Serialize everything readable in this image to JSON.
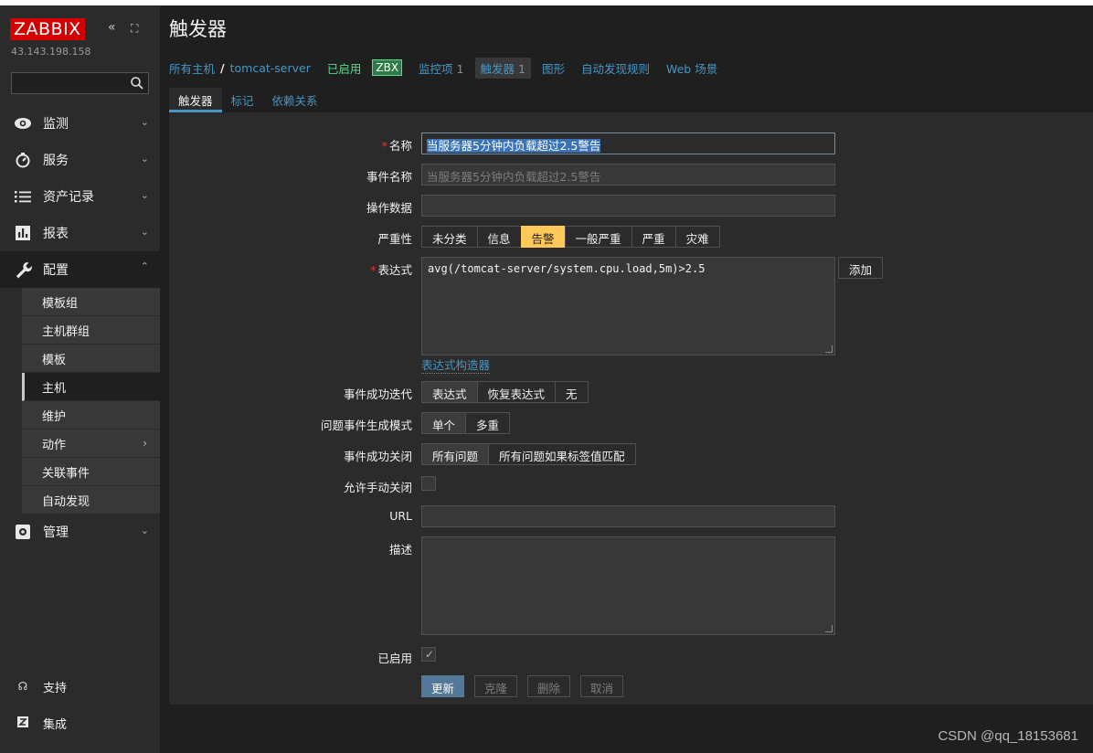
{
  "sidebar": {
    "logo": "ZABBIX",
    "collapse_glyph": "«",
    "kiosk_glyph": "⛶",
    "server_ip": "43.143.198.158",
    "search_value": "",
    "menu": [
      {
        "label": "监测",
        "icon": "eye-icon"
      },
      {
        "label": "服务",
        "icon": "stopwatch-icon"
      },
      {
        "label": "资产记录",
        "icon": "list-icon"
      },
      {
        "label": "报表",
        "icon": "bar-chart-icon"
      },
      {
        "label": "配置",
        "icon": "wrench-icon"
      },
      {
        "label": "管理",
        "icon": "gear-icon"
      }
    ],
    "submenu": [
      "模板组",
      "主机群组",
      "模板",
      "主机",
      "维护",
      "动作",
      "关联事件",
      "自动发现"
    ],
    "submenu_selected": "主机",
    "bottom": [
      {
        "label": "支持",
        "icon": "headset-icon"
      },
      {
        "label": "集成",
        "icon": "integration-icon"
      }
    ]
  },
  "header": {
    "title": "触发器"
  },
  "breadcrumbs": {
    "all_hosts": "所有主机",
    "separator": "/",
    "host": "tomcat-server",
    "status": "已启用",
    "zbx": "ZBX",
    "items_label": "监控项",
    "items_count": "1",
    "triggers_label": "触发器",
    "triggers_count": "1",
    "graphs_label": "图形",
    "discovery_label": "自动发现规则",
    "web_label": "Web 场景"
  },
  "tabs": [
    "触发器",
    "标记",
    "依赖关系"
  ],
  "form": {
    "name_label": "名称",
    "name_value": "当服务器5分钟内负载超过2.5警告",
    "event_name_label": "事件名称",
    "event_name_placeholder": "当服务器5分钟内负载超过2.5警告",
    "opdata_label": "操作数据",
    "opdata_value": "",
    "severity_label": "严重性",
    "severities": [
      "未分类",
      "信息",
      "告警",
      "一般严重",
      "严重",
      "灾难"
    ],
    "severity_selected": "告警",
    "expression_label": "表达式",
    "expression_value": "avg(/tomcat-server/system.cpu.load,5m)>2.5",
    "add_button": "添加",
    "expression_builder": "表达式构造器",
    "ok_event_gen_label": "事件成功迭代",
    "ok_event_gen_options": [
      "表达式",
      "恢复表达式",
      "无"
    ],
    "problem_mode_label": "问题事件生成模式",
    "problem_mode_options": [
      "单个",
      "多重"
    ],
    "ok_close_label": "事件成功关闭",
    "ok_close_options": [
      "所有问题",
      "所有问题如果标签值匹配"
    ],
    "manual_close_label": "允许手动关闭",
    "url_label": "URL",
    "url_value": "",
    "description_label": "描述",
    "description_value": "",
    "enabled_label": "已启用",
    "enabled_check": "✓",
    "buttons": {
      "update": "更新",
      "clone": "克隆",
      "delete": "删除",
      "cancel": "取消"
    }
  },
  "watermark": "CSDN @qq_18153681",
  "colors": {
    "brand_red": "#d40000",
    "accent_blue": "#4796c4",
    "warning_yellow": "#ffc859",
    "enabled_green": "#59db8f"
  }
}
